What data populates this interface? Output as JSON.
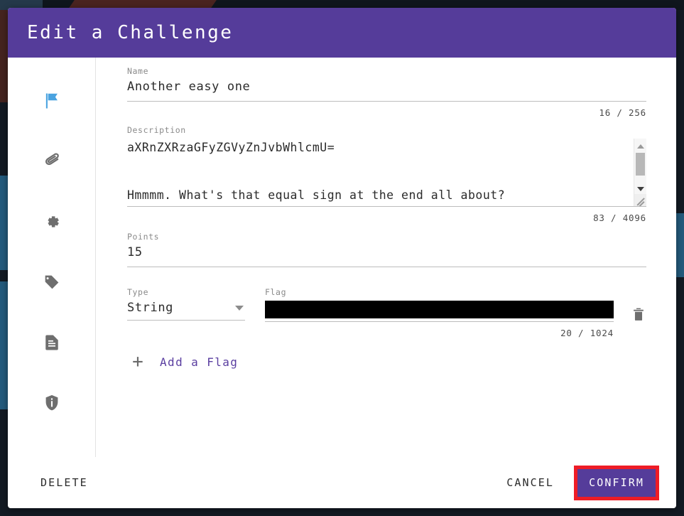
{
  "modal": {
    "title": "Edit a Challenge",
    "header_color": "#553c9a",
    "accent_color": "#5a3ea0",
    "highlight_color": "#ee1c26"
  },
  "sidebar": {
    "items": [
      {
        "icon": "flag-icon",
        "name": "sidebar-item-challenge",
        "active": true,
        "color": "#4aa3e0"
      },
      {
        "icon": "paperclip-icon",
        "name": "sidebar-item-files",
        "active": false,
        "color": "#6e6e6e"
      },
      {
        "icon": "gear-icon",
        "name": "sidebar-item-settings",
        "active": false,
        "color": "#6e6e6e"
      },
      {
        "icon": "tag-icon",
        "name": "sidebar-item-tags",
        "active": false,
        "color": "#6e6e6e"
      },
      {
        "icon": "document-icon",
        "name": "sidebar-item-writeup",
        "active": false,
        "color": "#6e6e6e"
      },
      {
        "icon": "shield-info-icon",
        "name": "sidebar-item-hints",
        "active": false,
        "color": "#6e6e6e"
      }
    ]
  },
  "form": {
    "name": {
      "label": "Name",
      "value": "Another easy one",
      "counter": "16 / 256"
    },
    "description": {
      "label": "Description",
      "line1": "aXRnZXRzaGFyZGVyZnJvbWhlcmU=",
      "line2": "Hmmmm. What's that equal sign at the end all about?",
      "counter": "83 / 4096"
    },
    "points": {
      "label": "Points",
      "value": "15"
    },
    "type": {
      "label": "Type",
      "value": "String"
    },
    "flag": {
      "label": "Flag",
      "value": "",
      "redacted": true,
      "counter": "20 / 1024"
    },
    "add_flag_label": "Add a Flag"
  },
  "footer": {
    "delete_label": "DELETE",
    "cancel_label": "CANCEL",
    "confirm_label": "CONFIRM"
  }
}
